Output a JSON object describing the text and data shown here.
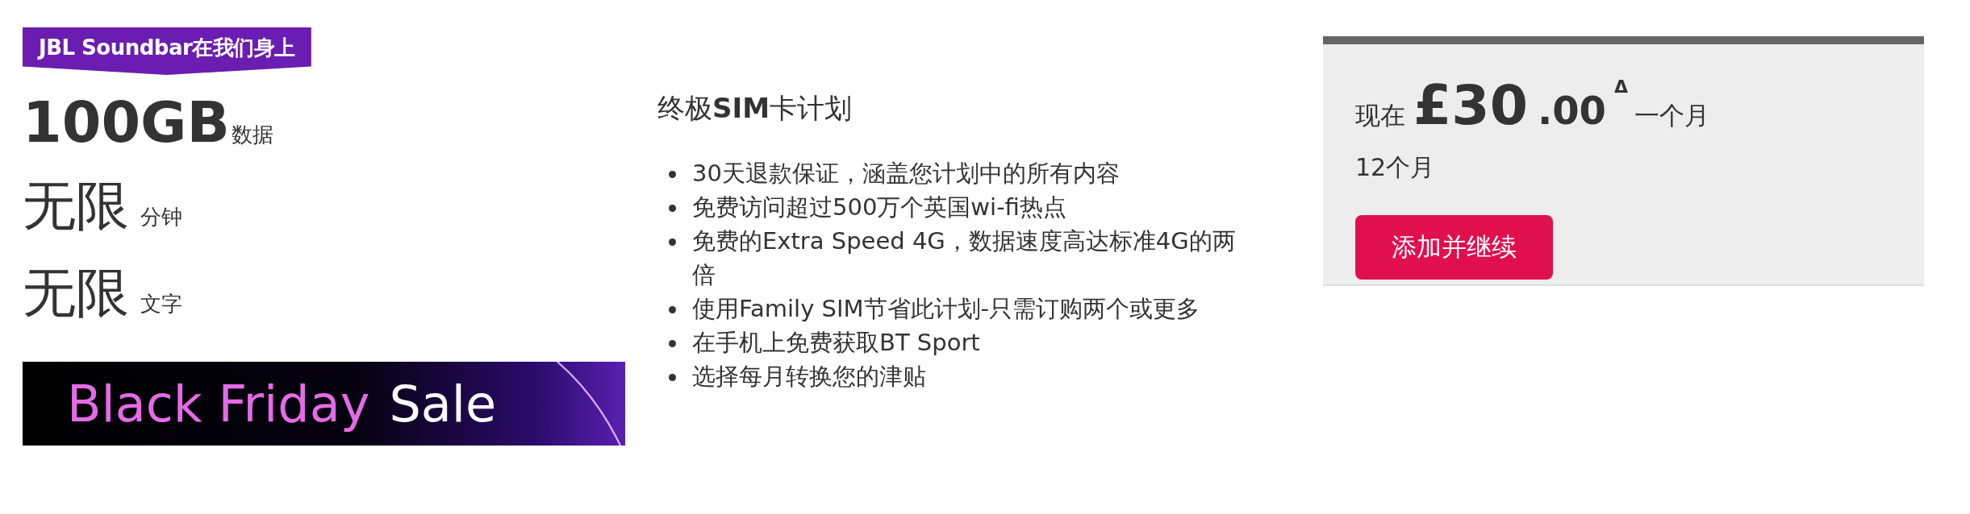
{
  "badge": "JBL Soundbar在我们身上",
  "allowances": [
    {
      "amount": "100GB",
      "unit": "数据",
      "kind": "bold"
    },
    {
      "amount": "无限",
      "unit": "分钟",
      "kind": "plain"
    },
    {
      "amount": "无限",
      "unit": "文字",
      "kind": "plain"
    }
  ],
  "banner": {
    "highlight": "Black Friday",
    "text": "Sale"
  },
  "plan": {
    "title": "终极**SIM**卡计划",
    "features": [
      "30天退款保证，涵盖您计划中的所有内容",
      "免费访问超过500万个英国wi-fi热点",
      "免费的Extra Speed 4G，数据速度高达标准4G的两倍",
      "使用Family SIM节省此计划-只需订购两个或更多",
      "在手机上免费获取BT Sport",
      "选择每月转换您的津贴"
    ]
  },
  "price": {
    "prefix": "现在",
    "pounds": "£30",
    "pence": ".00",
    "mark": "Δ",
    "period": "一个月",
    "term": "12个月",
    "button": "添加并继续"
  }
}
